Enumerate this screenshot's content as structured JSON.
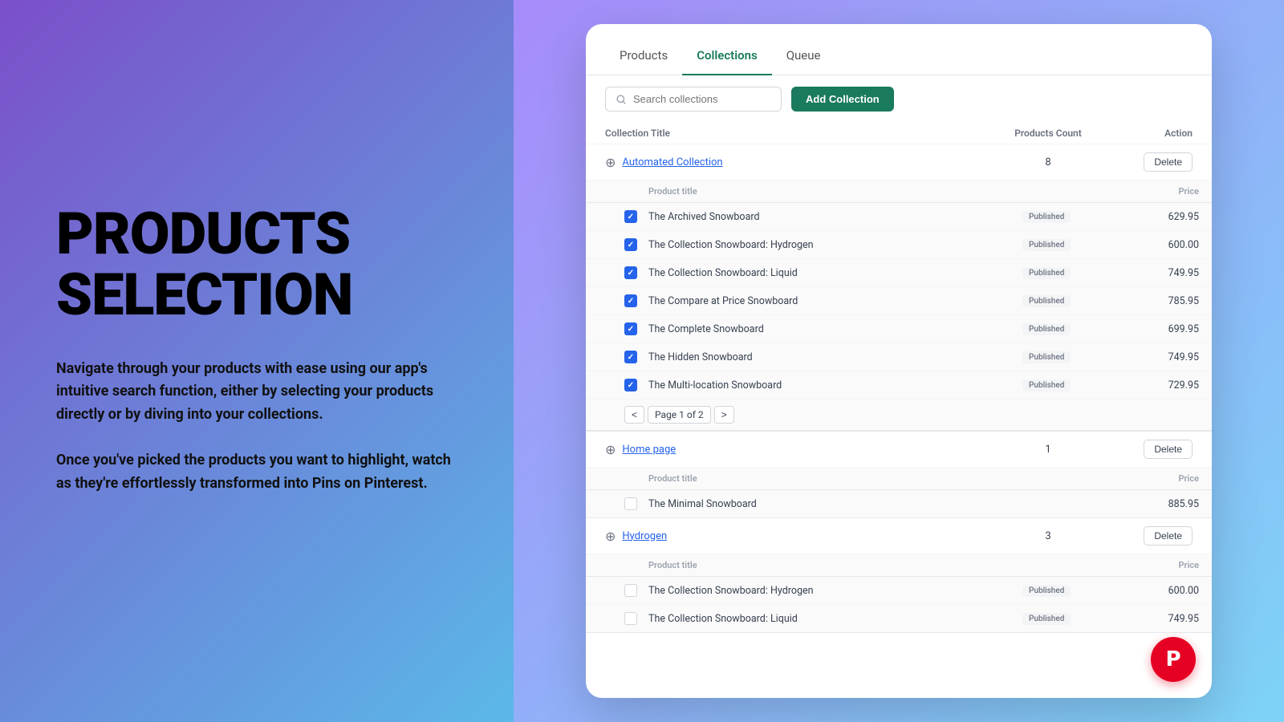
{
  "left": {
    "heading_line1": "PRODUCTS",
    "heading_line2": "SELECTION",
    "paragraph1": "Navigate through your products with ease using our app's intuitive search function, either by selecting your products directly or by diving into your collections.",
    "paragraph2": "Once you've picked the products you want to highlight, watch as they're effortlessly transformed into Pins on Pinterest."
  },
  "app": {
    "tabs": [
      {
        "label": "Products",
        "active": false
      },
      {
        "label": "Collections",
        "active": true
      },
      {
        "label": "Queue",
        "active": false
      }
    ],
    "toolbar": {
      "search_placeholder": "Search collections",
      "add_button_label": "Add Collection"
    },
    "table_header": {
      "title_col": "Collection Title",
      "count_col": "Products Count",
      "action_col": "Action"
    },
    "collections": [
      {
        "name": "Automated Collection",
        "count": 8,
        "products": [
          {
            "name": "The Archived Snowboard",
            "status": "Published",
            "price": "629.95",
            "checked": true
          },
          {
            "name": "The Collection Snowboard: Hydrogen",
            "status": "Published",
            "price": "600.00",
            "checked": true
          },
          {
            "name": "The Collection Snowboard: Liquid",
            "status": "Published",
            "price": "749.95",
            "checked": true
          },
          {
            "name": "The Compare at Price Snowboard",
            "status": "Published",
            "price": "785.95",
            "checked": true
          },
          {
            "name": "The Complete Snowboard",
            "status": "Published",
            "price": "699.95",
            "checked": true
          },
          {
            "name": "The Hidden Snowboard",
            "status": "Published",
            "price": "749.95",
            "checked": true
          },
          {
            "name": "The Multi-location Snowboard",
            "status": "Published",
            "price": "729.95",
            "checked": true
          }
        ],
        "pagination": {
          "text": "Page 1 of 2"
        }
      },
      {
        "name": "Home page",
        "count": 1,
        "products": [
          {
            "name": "The Minimal Snowboard",
            "status": "",
            "price": "885.95",
            "checked": false
          }
        ],
        "pagination": null
      },
      {
        "name": "Hydrogen",
        "count": 3,
        "products": [
          {
            "name": "The Collection Snowboard: Hydrogen",
            "status": "Published",
            "price": "600.00",
            "checked": false
          },
          {
            "name": "The Collection Snowboard: Liquid",
            "status": "Published",
            "price": "749.95",
            "checked": false
          }
        ],
        "pagination": null
      }
    ],
    "delete_label": "Delete",
    "product_title_col": "Product title",
    "price_col": "Price"
  }
}
